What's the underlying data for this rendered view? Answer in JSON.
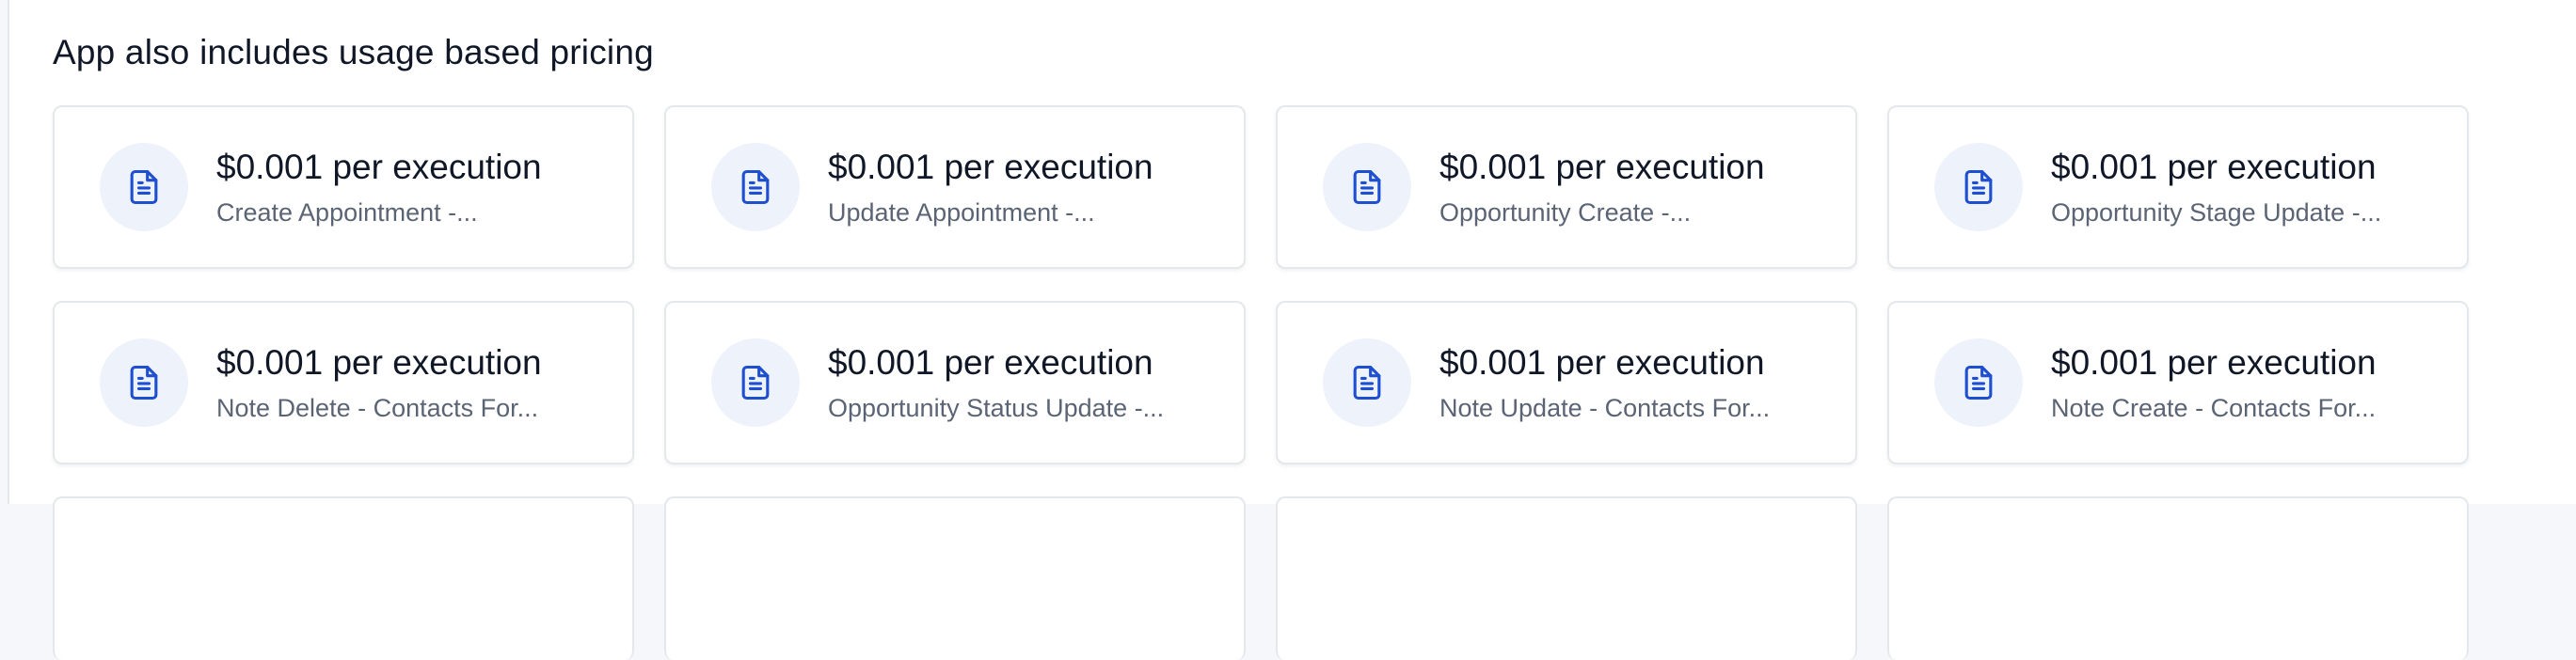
{
  "section": {
    "title": "App also includes usage based pricing"
  },
  "pricing_cards": [
    {
      "price": "$0.001 per execution",
      "description": "Create Appointment -...",
      "icon": "document-icon"
    },
    {
      "price": "$0.001 per execution",
      "description": "Update Appointment -...",
      "icon": "document-icon"
    },
    {
      "price": "$0.001 per execution",
      "description": "Opportunity Create -...",
      "icon": "document-icon"
    },
    {
      "price": "$0.001 per execution",
      "description": "Opportunity Stage Update -...",
      "icon": "document-icon"
    },
    {
      "price": "$0.001 per execution",
      "description": "Note Delete - Contacts For...",
      "icon": "document-icon"
    },
    {
      "price": "$0.001 per execution",
      "description": "Opportunity Status Update -...",
      "icon": "document-icon"
    },
    {
      "price": "$0.001 per execution",
      "description": "Note Update - Contacts For...",
      "icon": "document-icon"
    },
    {
      "price": "$0.001 per execution",
      "description": "Note Create - Contacts For...",
      "icon": "document-icon"
    }
  ],
  "colors": {
    "icon_accent": "#1f4fd1",
    "icon_background": "#eef2fb",
    "card_border": "#e4e7ec",
    "description_text": "#5b6475"
  }
}
